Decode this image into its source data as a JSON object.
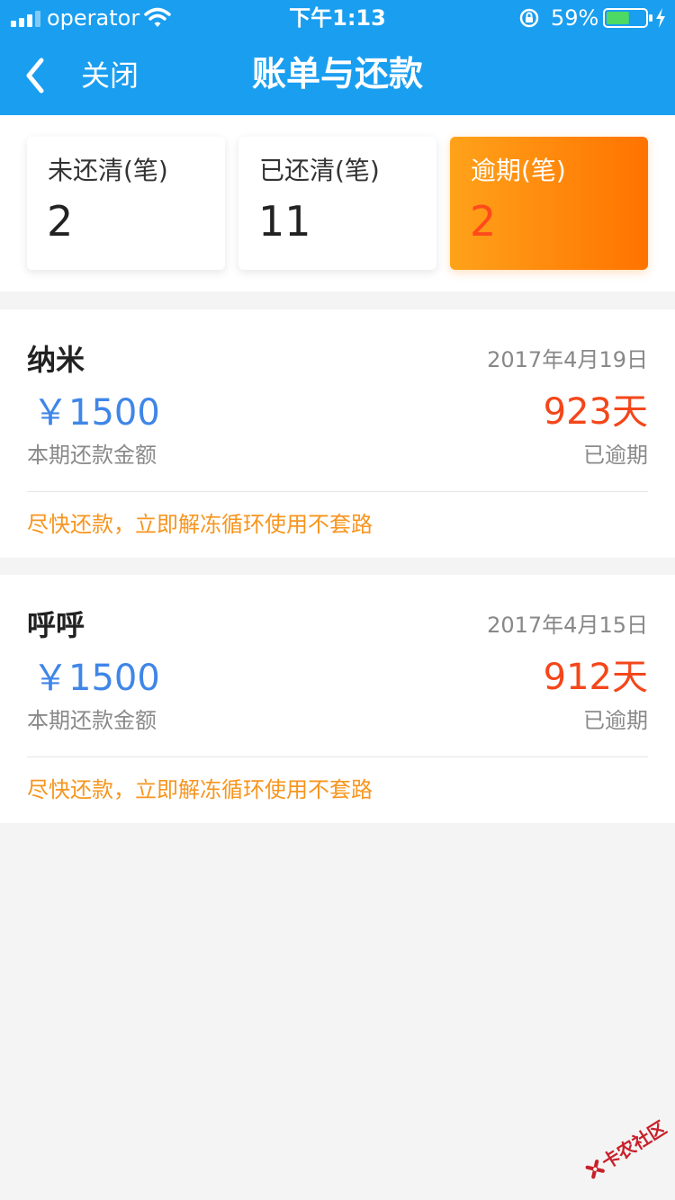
{
  "status_bar": {
    "carrier": "operator",
    "time": "下午1:13",
    "battery_percent": "59%",
    "battery_level": 0.59,
    "icons": [
      "signal-icon",
      "wifi-icon",
      "orientation-lock-icon",
      "battery-icon",
      "charging-icon"
    ]
  },
  "nav": {
    "back_icon": "chevron-left-icon",
    "close_label": "关闭",
    "title": "账单与还款"
  },
  "summary": {
    "cards": [
      {
        "label": "未还清(笔)",
        "count": "2"
      },
      {
        "label": "已还清(笔)",
        "count": "11"
      },
      {
        "label": "逾期(笔)",
        "count": "2"
      }
    ]
  },
  "bills": [
    {
      "name": "纳米",
      "date": "2017年4月19日",
      "amount": "￥1500",
      "amount_label": "本期还款金额",
      "days": "923天",
      "status": "已逾期",
      "notice": "尽快还款，立即解冻循环使用不套路"
    },
    {
      "name": "呼呼",
      "date": "2017年4月15日",
      "amount": "￥1500",
      "amount_label": "本期还款金额",
      "days": "912天",
      "status": "已逾期",
      "notice": "尽快还款，立即解冻循环使用不套路"
    }
  ],
  "watermark": {
    "text": "卡农社区"
  },
  "colors": {
    "header": "#1a9ef0",
    "amount": "#3f86e8",
    "overdue": "#f4461a",
    "notice": "#f7951e",
    "overdue_card_start": "#ffa21a",
    "overdue_card_end": "#ff7300"
  }
}
